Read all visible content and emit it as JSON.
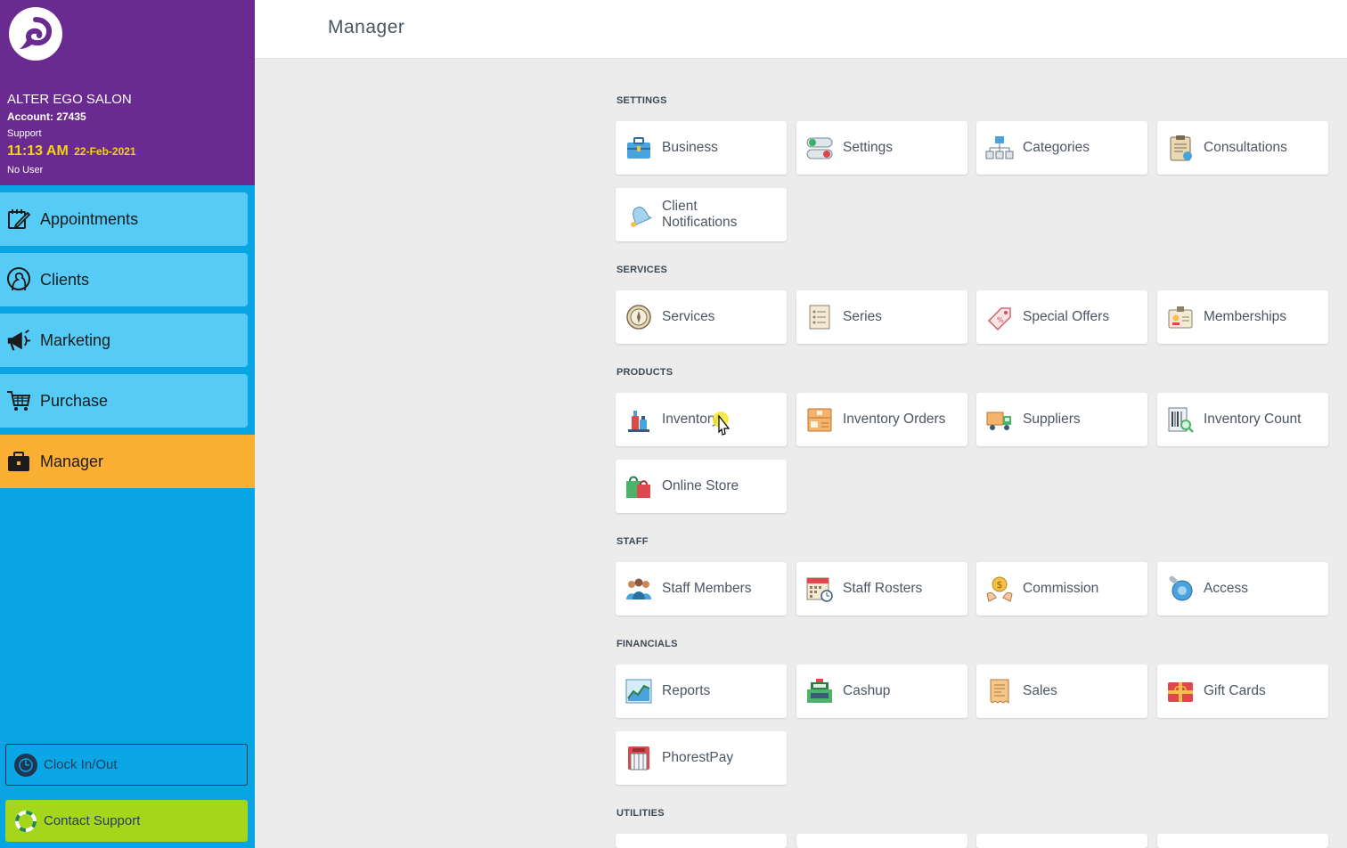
{
  "brand": {
    "salon_name": "ALTER EGO SALON",
    "account": "Account: 27435",
    "support": "Support",
    "time": "11:13 AM",
    "date": "22-Feb-2021",
    "user": "No User"
  },
  "nav": {
    "items": [
      {
        "label": "Appointments",
        "icon": "calendar-edit-icon"
      },
      {
        "label": "Clients",
        "icon": "client-head-icon"
      },
      {
        "label": "Marketing",
        "icon": "megaphone-icon"
      },
      {
        "label": "Purchase",
        "icon": "cart-icon"
      },
      {
        "label": "Manager",
        "icon": "briefcase-icon",
        "active": true
      }
    ],
    "clock_button": "Clock In/Out",
    "support_button": "Contact Support"
  },
  "header": {
    "title": "Manager"
  },
  "sections": [
    {
      "title": "SETTINGS",
      "tiles": [
        "Business",
        "Settings",
        "Categories",
        "Consultations",
        "Client Notifications"
      ]
    },
    {
      "title": "SERVICES",
      "tiles": [
        "Services",
        "Series",
        "Special Offers",
        "Memberships"
      ]
    },
    {
      "title": "PRODUCTS",
      "tiles": [
        "Inventory",
        "Inventory Orders",
        "Suppliers",
        "Inventory Count",
        "Online Store"
      ]
    },
    {
      "title": "STAFF",
      "tiles": [
        "Staff Members",
        "Staff Rosters",
        "Commission",
        "Access"
      ]
    },
    {
      "title": "FINANCIALS",
      "tiles": [
        "Reports",
        "Cashup",
        "Sales",
        "Gift Cards",
        "PhorestPay"
      ]
    },
    {
      "title": "UTILITIES",
      "tiles": []
    }
  ],
  "colors": {
    "brand_purple": "#6a2b91",
    "sidebar_blue": "#08a4e4",
    "nav_item": "#55cbf5",
    "active_orange": "#fbb034",
    "clock_yellow": "#f5d21a",
    "support_green": "#a5d61c"
  }
}
